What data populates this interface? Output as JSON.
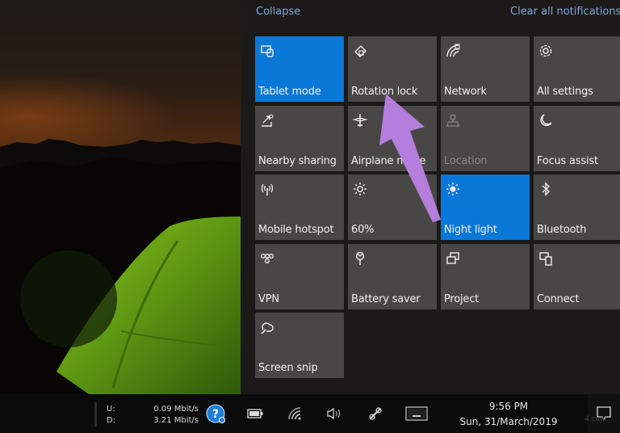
{
  "action_center": {
    "collapse_label": "Collapse",
    "clear_all_label": "Clear all notifications",
    "accent_color": "#0a78d7",
    "link_color": "#7fa6d6",
    "tiles": [
      {
        "label": "Tablet mode",
        "icon": "tablet-mode-icon",
        "state": "on"
      },
      {
        "label": "Rotation lock",
        "icon": "rotation-lock-icon",
        "state": "off"
      },
      {
        "label": "Network",
        "icon": "network-icon",
        "state": "off"
      },
      {
        "label": "All settings",
        "icon": "gear-icon",
        "state": "off"
      },
      {
        "label": "Nearby sharing",
        "icon": "nearby-sharing-icon",
        "state": "off"
      },
      {
        "label": "Airplane mode",
        "icon": "airplane-icon",
        "state": "off"
      },
      {
        "label": "Location",
        "icon": "location-icon",
        "state": "disabled"
      },
      {
        "label": "Focus assist",
        "icon": "moon-icon",
        "state": "off"
      },
      {
        "label": "Mobile hotspot",
        "icon": "hotspot-icon",
        "state": "off"
      },
      {
        "label": "60%",
        "icon": "brightness-icon",
        "state": "off"
      },
      {
        "label": "Night light",
        "icon": "night-light-icon",
        "state": "on"
      },
      {
        "label": "Bluetooth",
        "icon": "bluetooth-icon",
        "state": "off"
      },
      {
        "label": "VPN",
        "icon": "vpn-icon",
        "state": "off"
      },
      {
        "label": "Battery saver",
        "icon": "battery-saver-icon",
        "state": "off"
      },
      {
        "label": "Project",
        "icon": "project-icon",
        "state": "off"
      },
      {
        "label": "Connect",
        "icon": "connect-icon",
        "state": "off"
      },
      {
        "label": "Screen snip",
        "icon": "screen-snip-icon",
        "state": "off"
      }
    ]
  },
  "annotation": {
    "type": "arrow",
    "color": "#b57edc",
    "points_to": "Rotation lock"
  },
  "taskbar": {
    "net_upload_label": "U:",
    "net_download_label": "D:",
    "net_upload_value": "0.09 Mbit/s",
    "net_download_value": "3.21 Mbit/s",
    "icons": [
      "help-icon",
      "battery-icon",
      "wifi-icon",
      "volume-icon",
      "pen-icon",
      "keyboard-icon"
    ],
    "time": "9:56 PM",
    "date": "Sun, 31/March/2019",
    "watermark": "4.com"
  }
}
